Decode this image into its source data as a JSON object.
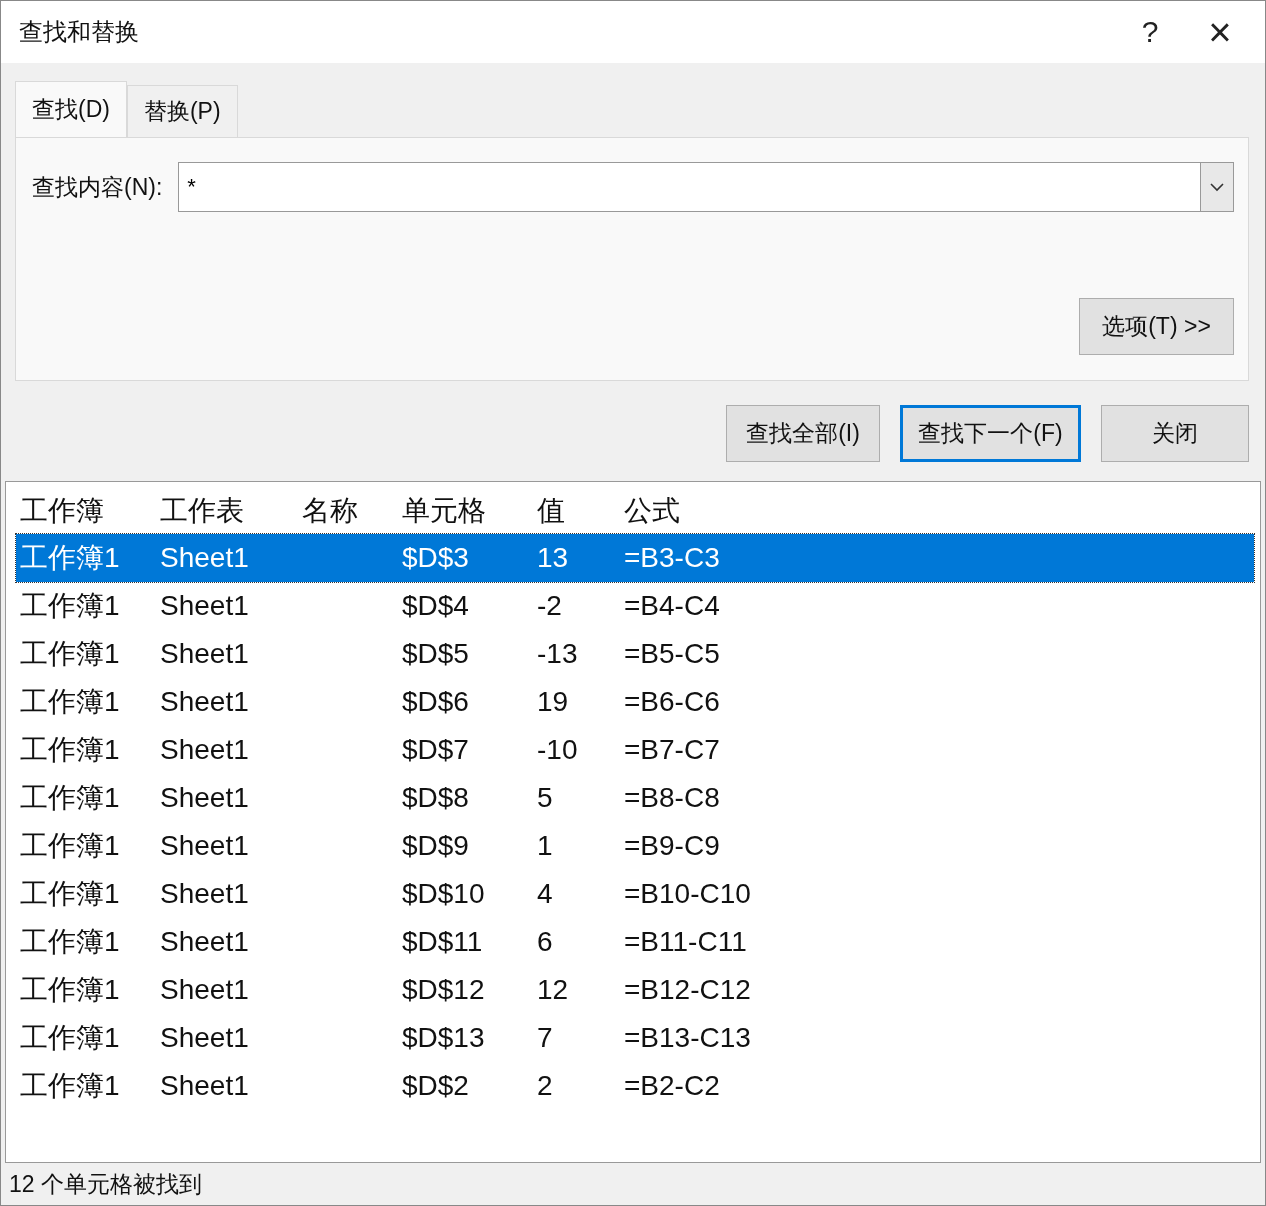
{
  "window": {
    "title": "查找和替换",
    "help": "?",
    "close": "×"
  },
  "tabs": [
    {
      "label": "查找(D)",
      "selected": true
    },
    {
      "label": "替换(P)",
      "selected": false
    }
  ],
  "find_field": {
    "label": "查找内容(N):",
    "value": "*"
  },
  "options_button": "选项(T) >>",
  "buttons": [
    {
      "label": "查找全部(I)",
      "selected": false
    },
    {
      "label": "查找下一个(F)",
      "selected": true
    },
    {
      "label": "关闭",
      "selected": false
    }
  ],
  "results": {
    "columns": [
      "工作簿",
      "工作表",
      "名称",
      "单元格",
      "值",
      "公式"
    ],
    "rows": [
      {
        "workbook": "工作簿1",
        "sheet": "Sheet1",
        "cell": "$D$3",
        "value": "13",
        "formula": "=B3-C3",
        "selected": true
      },
      {
        "workbook": "工作簿1",
        "sheet": "Sheet1",
        "cell": "$D$4",
        "value": "-2",
        "formula": "=B4-C4",
        "selected": false
      },
      {
        "workbook": "工作簿1",
        "sheet": "Sheet1",
        "cell": "$D$5",
        "value": "-13",
        "formula": "=B5-C5",
        "selected": false
      },
      {
        "workbook": "工作簿1",
        "sheet": "Sheet1",
        "cell": "$D$6",
        "value": "19",
        "formula": "=B6-C6",
        "selected": false
      },
      {
        "workbook": "工作簿1",
        "sheet": "Sheet1",
        "cell": "$D$7",
        "value": "-10",
        "formula": "=B7-C7",
        "selected": false
      },
      {
        "workbook": "工作簿1",
        "sheet": "Sheet1",
        "cell": "$D$8",
        "value": "5",
        "formula": "=B8-C8",
        "selected": false
      },
      {
        "workbook": "工作簿1",
        "sheet": "Sheet1",
        "cell": "$D$9",
        "value": "1",
        "formula": "=B9-C9",
        "selected": false
      },
      {
        "workbook": "工作簿1",
        "sheet": "Sheet1",
        "cell": "$D$10",
        "value": "4",
        "formula": "=B10-C10",
        "selected": false
      },
      {
        "workbook": "工作簿1",
        "sheet": "Sheet1",
        "cell": "$D$11",
        "value": "6",
        "formula": "=B11-C11",
        "selected": false
      },
      {
        "workbook": "工作簿1",
        "sheet": "Sheet1",
        "cell": "$D$12",
        "value": "12",
        "formula": "=B12-C12",
        "selected": false
      },
      {
        "workbook": "工作簿1",
        "sheet": "Sheet1",
        "cell": "$D$13",
        "value": "7",
        "formula": "=B13-C13",
        "selected": false
      },
      {
        "workbook": "工作簿1",
        "sheet": "Sheet1",
        "cell": "$D$2",
        "value": "2",
        "formula": "=B2-C2",
        "selected": false
      }
    ]
  },
  "status_bar": "12 个单元格被找到"
}
